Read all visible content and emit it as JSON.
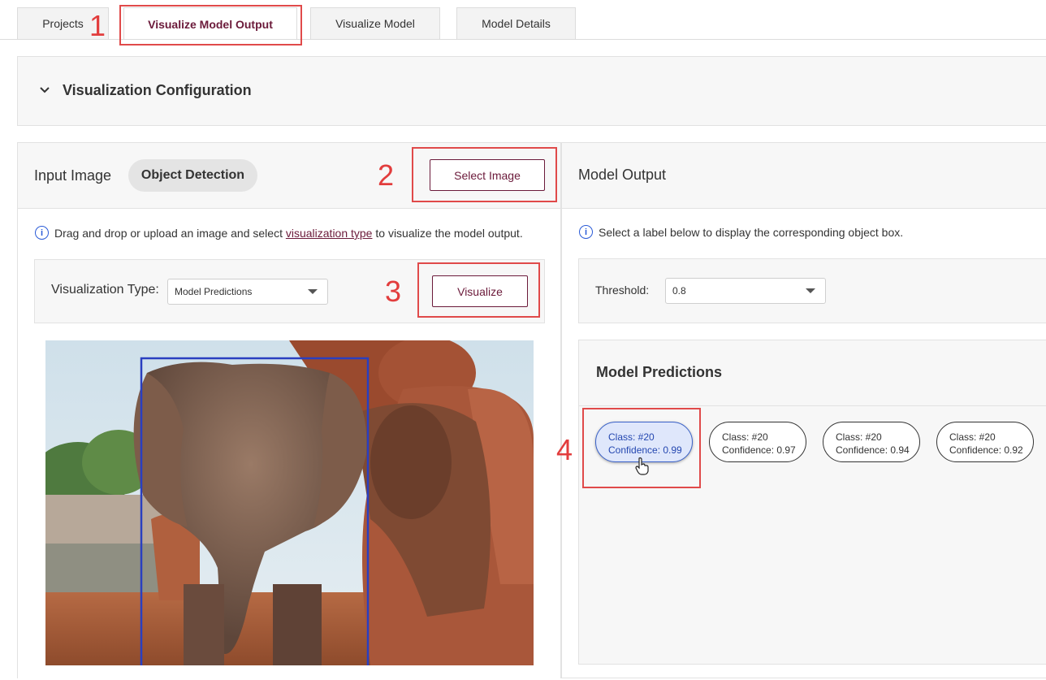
{
  "tabs": [
    {
      "label": "Projects"
    },
    {
      "label": "Visualize Model Output"
    },
    {
      "label": "Visualize Model"
    },
    {
      "label": "Model Details"
    }
  ],
  "annotations": [
    "1",
    "2",
    "3",
    "4"
  ],
  "config": {
    "title": "Visualization Configuration"
  },
  "input": {
    "title": "Input Image",
    "pill": "Object Detection",
    "select_image": "Select Image",
    "info_prefix": "Drag and drop or upload an image and select ",
    "info_link": "visualization type",
    "info_suffix": " to visualize the model output.",
    "vis_type_label": "Visualization Type:",
    "vis_type_value": "Model Predictions",
    "visualize_button": "Visualize"
  },
  "output": {
    "title": "Model Output",
    "info": "Select a label below to display the corresponding object box.",
    "threshold_label": "Threshold:",
    "threshold_value": "0.8",
    "predictions_title": "Model Predictions",
    "predictions": [
      {
        "class": "Class: #20",
        "confidence": "Confidence: 0.99"
      },
      {
        "class": "Class: #20",
        "confidence": "Confidence: 0.97"
      },
      {
        "class": "Class: #20",
        "confidence": "Confidence: 0.94"
      },
      {
        "class": "Class: #20",
        "confidence": "Confidence: 0.92"
      }
    ]
  },
  "colors": {
    "brand": "#6b1a3a",
    "annotation": "#e04a4a",
    "box": "#2a3fc0",
    "selected_chip": "#dfe7fb"
  },
  "icons": [
    "chevron-down-icon",
    "info-icon",
    "caret-down-icon",
    "pointer-hand-icon"
  ]
}
